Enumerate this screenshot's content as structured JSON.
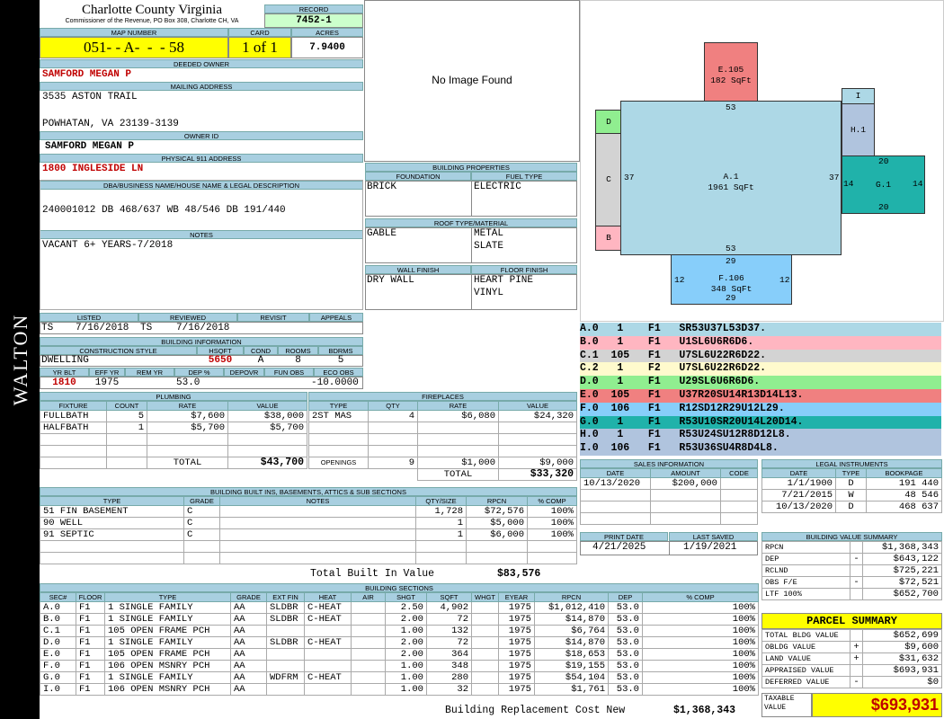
{
  "side_label": "WALTON",
  "county": "Charlotte County Virginia",
  "commissioner": "Commissioner of the Revenue, PO Box 308, Charlotte CH, VA",
  "labels": {
    "record": "RECORD",
    "map_number": "MAP NUMBER",
    "card": "CARD",
    "acres": "ACRES",
    "deeded_owner": "DEEDED OWNER",
    "mailing_address": "MAILING ADDRESS",
    "owner_id": "OWNER ID",
    "physical_address": "PHYSICAL 911 ADDRESS",
    "dba": "DBA/BUSINESS NAME/HOUSE NAME & LEGAL DESCRIPTION",
    "notes": "NOTES",
    "listed": "LISTED",
    "reviewed": "REVIEWED",
    "revisit": "REVISIT",
    "appeals": "APPEALS",
    "building_info": "BUILDING INFORMATION",
    "construction_style": "CONSTRUCTION STYLE",
    "hsqft": "HSQFT",
    "cond": "COND",
    "rooms": "ROOMS",
    "bdrms": "BDRMS",
    "yr_blt": "YR BLT",
    "eff_yr": "EFF YR",
    "rem_yr": "REM YR",
    "dep_pct": "DEP %",
    "depovr": "DEPOVR",
    "fun_obs": "FUN OBS",
    "eco_obs": "ECO OBS",
    "plumbing": "PLUMBING",
    "fireplaces": "FIREPLACES",
    "building_properties": "BUILDING PROPERTIES",
    "foundation": "FOUNDATION",
    "fuel_type": "FUEL TYPE",
    "roof": "ROOF TYPE/MATERIAL",
    "wall_finish": "WALL FINISH",
    "floor_finish": "FLOOR FINISH",
    "sales_info": "SALES INFORMATION",
    "legal_instruments": "LEGAL INSTRUMENTS",
    "print_date": "PRINT DATE",
    "last_saved": "LAST SAVED",
    "bvs": "BUILDING VALUE SUMMARY",
    "built_ins": "BUILDING BUILT INS, BASEMENTS, ATTICS & SUB SECTIONS",
    "building_sections": "BUILDING SECTIONS",
    "parcel_summary": "PARCEL SUMMARY",
    "taxable_value": "TAXABLE VALUE",
    "total": "TOTAL",
    "openings": "OPENINGS",
    "total_built_in": "Total Built In Value",
    "brcn": "Building Replacement Cost New",
    "no_image": "No Image Found"
  },
  "record": "7452-1",
  "map_number": "051- - A-  -  - 58",
  "card": "1 of 1",
  "acres": "7.9400",
  "deeded_owner": "SAMFORD MEGAN P",
  "mailing_line1": "3535 ASTON TRAIL",
  "mailing_line2": "POWHATAN, VA 23139-3139",
  "owner_id": "SAMFORD MEGAN P",
  "physical_address": "1800 INGLESIDE LN",
  "dba": "240001012 DB 468/637 WB 48/546 DB 191/440",
  "notes": "VACANT 6+ YEARS-7/2018",
  "listed_by": "TS",
  "listed_date": "7/16/2018",
  "reviewed_by": "TS",
  "reviewed_date": "7/16/2018",
  "bi": {
    "style": "DWELLING",
    "hsqft": "5650",
    "cond": "A",
    "rooms": "8",
    "bdrms": "5",
    "yr_blt": "1810",
    "eff_yr": "1975",
    "dep": "53.0",
    "eco_obs": "-10.0000"
  },
  "plumbing": {
    "headers": [
      "FIXTURE",
      "COUNT",
      "RATE",
      "VALUE"
    ],
    "rows": [
      [
        "FULLBATH",
        "5",
        "$7,600",
        "$38,000"
      ],
      [
        "HALFBATH",
        "1",
        "$5,700",
        "$5,700"
      ]
    ],
    "total": "$43,700"
  },
  "fireplaces": {
    "headers": [
      "TYPE",
      "QTY",
      "RATE",
      "VALUE"
    ],
    "rows": [
      [
        "2ST MAS",
        "4",
        "$6,080",
        "$24,320"
      ]
    ],
    "openings": [
      "9",
      "$1,000",
      "$9,000"
    ],
    "total": "$33,320"
  },
  "props": {
    "foundation": "BRICK",
    "fuel": "ELECTRIC",
    "roof1": "GABLE",
    "roof2a": "METAL",
    "roof2b": "SLATE",
    "wall": "DRY WALL",
    "floor1": "HEART PINE",
    "floor2": "VINYL"
  },
  "sketch": {
    "e105": "E.105",
    "e105_area": "182 SqFt",
    "a1": "A.1",
    "a1_area": "1961 SqFt",
    "g1": "G.1",
    "f106": "F.106",
    "f106_area": "348 SqFt",
    "h1": "H.1",
    "i": "I",
    "b": "B",
    "c": "C",
    "d": "D",
    "d53t": "53",
    "d53b": "53",
    "d37l": "37",
    "d37r": "37",
    "d14l": "14",
    "d14r": "14",
    "d20t": "20",
    "d20b": "20",
    "d29t": "29",
    "d29b": "29",
    "d12l": "12",
    "d12r": "12"
  },
  "legend": [
    {
      "text": "A.0   1    F1   SR53U37L53D37.",
      "color": "#add8e6"
    },
    {
      "text": "B.0   1    F1   U1SL6U6R6D6.",
      "color": "#ffb6c1"
    },
    {
      "text": "C.1  105   F1   U7SL6U22R6D22.",
      "color": "#d3d3d3"
    },
    {
      "text": "C.2   1    F2   U7SL6U22R6D22.",
      "color": "#fffacd"
    },
    {
      "text": "D.0   1    F1   U29SL6U6R6D6.",
      "color": "#90ee90"
    },
    {
      "text": "E.0  105   F1   U37R20SU14R13D14L13.",
      "color": "#f08080"
    },
    {
      "text": "F.0  106   F1   R12SD12R29U12L29.",
      "color": "#87cefa"
    },
    {
      "text": "G.0   1    F1   R53U10SR20U14L20D14.",
      "color": "#20b2aa"
    },
    {
      "text": "H.0   1    F1   R53U24SU12R8D12L8.",
      "color": "#b0c4de"
    },
    {
      "text": "I.0  106   F1   R53U36SU4R8D4L8.",
      "color": "#b0c4de"
    }
  ],
  "sales": {
    "headers": [
      "DATE",
      "AMOUNT",
      "CODE"
    ],
    "rows": [
      [
        "10/13/2020",
        "$200,000",
        ""
      ]
    ]
  },
  "legal": {
    "headers": [
      "DATE",
      "TYPE",
      "BOOKPAGE"
    ],
    "rows": [
      [
        "1/1/1900",
        "D",
        "191 440"
      ],
      [
        "7/21/2015",
        "W",
        "48 546"
      ],
      [
        "10/13/2020",
        "D",
        "468 637"
      ]
    ]
  },
  "print_date": "4/21/2025",
  "last_saved": "1/19/2021",
  "bvs": [
    [
      "RPCN",
      "",
      "$1,368,343"
    ],
    [
      "DEP",
      "-",
      "$643,122"
    ],
    [
      "RCLND",
      "",
      "$725,221"
    ],
    [
      "OBS F/E",
      "-",
      "$72,521"
    ],
    [
      "LTF  100%",
      "",
      "$652,700"
    ]
  ],
  "parcel": [
    [
      "TOTAL BLDG VALUE",
      "",
      "$652,699"
    ],
    [
      "OBLDG VALUE",
      "+",
      "$9,600"
    ],
    [
      "LAND VALUE",
      "+",
      "$31,632"
    ],
    [
      "APPRAISED VALUE",
      "",
      "$693,931"
    ],
    [
      "DEFERRED VALUE",
      "-",
      "$0"
    ]
  ],
  "taxable": "$693,931",
  "builtins": {
    "headers": [
      "TYPE",
      "GRADE",
      "NOTES",
      "QTY/SIZE",
      "RPCN",
      "% COMP"
    ],
    "rows": [
      [
        "51 FIN BASEMENT",
        "C",
        "",
        "1,728",
        "$72,576",
        "100%"
      ],
      [
        "90 WELL",
        "C",
        "",
        "1",
        "$5,000",
        "100%"
      ],
      [
        "91 SEPTIC",
        "C",
        "",
        "1",
        "$6,000",
        "100%"
      ]
    ],
    "total": "$83,576"
  },
  "sections": {
    "headers": [
      "SEC#",
      "FLOOR",
      "TYPE",
      "GRADE",
      "EXT FIN",
      "HEAT",
      "AIR",
      "SHGT",
      "SQFT",
      "WHGT",
      "EYEAR",
      "RPCN",
      "DEP",
      "% COMP"
    ],
    "rows": [
      [
        "A.0",
        "F1",
        "1 SINGLE FAMILY",
        "AA",
        "SLDBR",
        "C-HEAT",
        "",
        "2.50",
        "4,902",
        "",
        "1975",
        "$1,012,410",
        "53.0",
        "100%"
      ],
      [
        "B.0",
        "F1",
        "1 SINGLE FAMILY",
        "AA",
        "SLDBR",
        "C-HEAT",
        "",
        "2.00",
        "72",
        "",
        "1975",
        "$14,870",
        "53.0",
        "100%"
      ],
      [
        "C.1",
        "F1",
        "105 OPEN FRAME PCH",
        "AA",
        "",
        "",
        "",
        "1.00",
        "132",
        "",
        "1975",
        "$6,764",
        "53.0",
        "100%"
      ],
      [
        "D.0",
        "F1",
        "1 SINGLE FAMILY",
        "AA",
        "SLDBR",
        "C-HEAT",
        "",
        "2.00",
        "72",
        "",
        "1975",
        "$14,870",
        "53.0",
        "100%"
      ],
      [
        "E.0",
        "F1",
        "105 OPEN FRAME PCH",
        "AA",
        "",
        "",
        "",
        "2.00",
        "364",
        "",
        "1975",
        "$18,653",
        "53.0",
        "100%"
      ],
      [
        "F.0",
        "F1",
        "106 OPEN MSNRY PCH",
        "AA",
        "",
        "",
        "",
        "1.00",
        "348",
        "",
        "1975",
        "$19,155",
        "53.0",
        "100%"
      ],
      [
        "G.0",
        "F1",
        "1 SINGLE FAMILY",
        "AA",
        "WDFRM",
        "C-HEAT",
        "",
        "1.00",
        "280",
        "",
        "1975",
        "$54,104",
        "53.0",
        "100%"
      ],
      [
        "I.0",
        "F1",
        "106 OPEN MSNRY PCH",
        "AA",
        "",
        "",
        "",
        "1.00",
        "32",
        "",
        "1975",
        "$1,761",
        "53.0",
        "100%"
      ]
    ],
    "brcn": "$1,368,343"
  },
  "colors": {
    "header_bg": "#a8cfe0",
    "yellow": "#ffff00",
    "record_green": "#ccffcc",
    "taxable_red": "#c00000"
  }
}
